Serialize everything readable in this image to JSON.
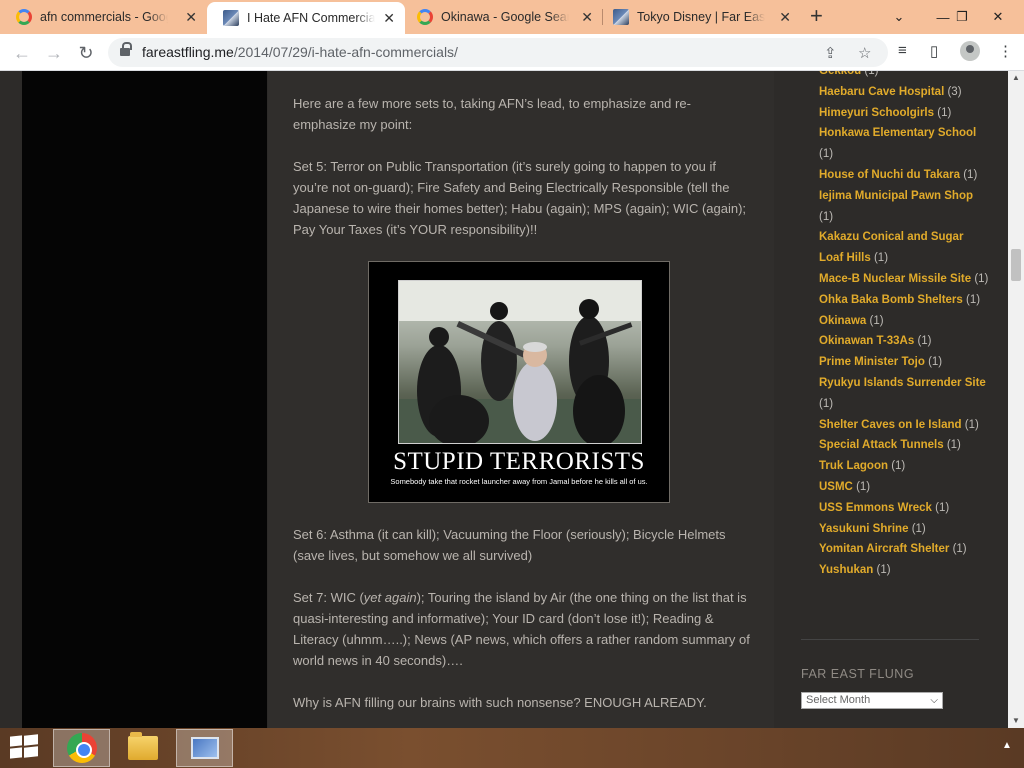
{
  "browser": {
    "tabs": [
      {
        "title": "afn commercials - Google Search",
        "icon": "google-icon",
        "active": false
      },
      {
        "title": "I Hate AFN Commercials | Far East Flung",
        "icon": "site-favicon",
        "active": true
      },
      {
        "title": "Okinawa - Google Search",
        "icon": "google-icon",
        "active": false
      },
      {
        "title": "Tokyo Disney | Far East Flung",
        "icon": "site-favicon",
        "active": false
      }
    ],
    "close_glyph": "✕",
    "new_tab_glyph": "+",
    "window_controls": {
      "dropdown": "⌄",
      "minimize": "—",
      "restore": "❐",
      "close": "✕"
    },
    "url_domain": "fareastfling.me",
    "url_path": "/2014/07/29/i-hate-afn-commercials/",
    "nav": {
      "back": "←",
      "forward": "→",
      "reload": "↻"
    },
    "icons": {
      "share": "⇪",
      "bookmark": "☆",
      "media": "≡",
      "sidepanel": "▯",
      "menu": "⋮"
    }
  },
  "article": {
    "intro": "Here are a few more sets to, taking AFN’s lead, to emphasize and re-emphasize my point:",
    "set5": "Set 5:     Terror on Public Transportation (it’s surely going to happen to you if you’re not on-guard); Fire Safety and Being Electrically Responsible (tell the Japanese to wire their homes better); Habu (again); MPS (again); WIC (again); Pay Your Taxes (it’s YOUR responsibility)!!",
    "poster": {
      "title": "STUPID TERRORISTS",
      "caption": "Somebody take that rocket launcher away from Jamal before he kills all of us."
    },
    "set6": "Set 6:     Asthma (it can kill); Vacuuming the Floor (seriously); Bicycle Helmets (save lives, but somehow we all survived)",
    "set7_prefix": "Set 7:     WIC (",
    "set7_italic": "yet again",
    "set7_rest": "); Touring the island by Air (the one thing on the list that is quasi-interesting and informative); Your ID card (don’t lose it!); Reading & Literacy (uhmm…..); News (AP news, which offers a rather random summary of world news in 40 seconds)….",
    "closing": "Why is AFN filling our brains with such nonsense?  ENOUGH ALREADY."
  },
  "sidebar": {
    "categories": [
      {
        "name": "Gekkou",
        "count": "(1)"
      },
      {
        "name": "Haebaru Cave Hospital",
        "count": "(3)"
      },
      {
        "name": "Himeyuri Schoolgirls",
        "count": "(1)"
      },
      {
        "name": "Honkawa Elementary School",
        "count": "(1)"
      },
      {
        "name": "House of Nuchi du Takara",
        "count": "(1)"
      },
      {
        "name": "Iejima Municipal Pawn Shop",
        "count": "(1)"
      },
      {
        "name": "Kakazu Conical and Sugar Loaf Hills",
        "count": "(1)"
      },
      {
        "name": "Mace-B Nuclear Missile Site",
        "count": "(1)"
      },
      {
        "name": "Ohka Baka Bomb Shelters",
        "count": "(1)"
      },
      {
        "name": "Okinawa",
        "count": "(1)"
      },
      {
        "name": "Okinawan T-33As",
        "count": "(1)"
      },
      {
        "name": "Prime Minister Tojo",
        "count": "(1)"
      },
      {
        "name": "Ryukyu Islands Surrender Site",
        "count": "(1)"
      },
      {
        "name": "Shelter Caves on Ie Island",
        "count": "(1)"
      },
      {
        "name": "Special Attack Tunnels",
        "count": "(1)"
      },
      {
        "name": "Truk Lagoon",
        "count": "(1)"
      },
      {
        "name": "USMC",
        "count": "(1)"
      },
      {
        "name": "USS Emmons Wreck",
        "count": "(1)"
      },
      {
        "name": "Yasukuni Shrine",
        "count": "(1)"
      },
      {
        "name": "Yomitan Aircraft Shelter",
        "count": "(1)"
      },
      {
        "name": "Yushukan",
        "count": "(1)"
      }
    ],
    "archive_title": "FAR EAST FLUNG",
    "archive_select": "Select Month"
  },
  "colors": {
    "link": "#e1ab2b",
    "body_text": "#b9b4ae",
    "tabstrip": "#f6c09a"
  }
}
